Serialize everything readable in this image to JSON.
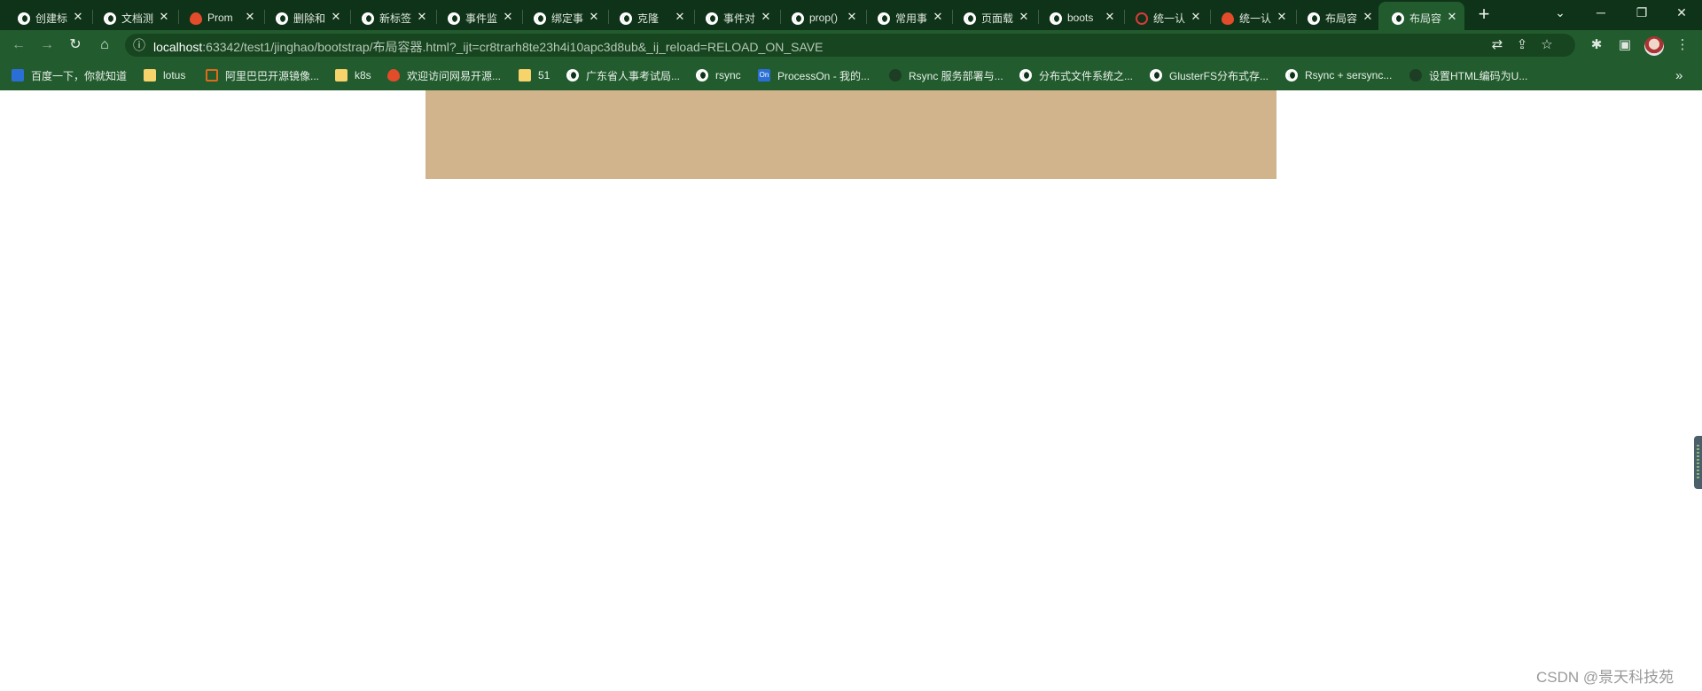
{
  "browser": {
    "tabs": [
      {
        "title": "创建标",
        "icon": "globe-icon"
      },
      {
        "title": "文档测",
        "icon": "globe-icon"
      },
      {
        "title": "Prom",
        "icon": "flame-icon"
      },
      {
        "title": "删除和",
        "icon": "globe-icon"
      },
      {
        "title": "新标签",
        "icon": "chrome-icon"
      },
      {
        "title": "事件监",
        "icon": "globe-icon"
      },
      {
        "title": "绑定事",
        "icon": "globe-icon"
      },
      {
        "title": "克隆",
        "icon": "globe-icon"
      },
      {
        "title": "事件对",
        "icon": "globe-icon"
      },
      {
        "title": "prop()",
        "icon": "globe-icon"
      },
      {
        "title": "常用事",
        "icon": "globe-icon"
      },
      {
        "title": "页面载",
        "icon": "globe-icon"
      },
      {
        "title": "boots",
        "icon": "globe-icon"
      },
      {
        "title": "统一认",
        "icon": "red-circle-icon"
      },
      {
        "title": "统一认",
        "icon": "colorful-icon"
      },
      {
        "title": "布局容",
        "icon": "globe-icon"
      },
      {
        "title": "布局容",
        "icon": "globe-icon",
        "active": true
      }
    ],
    "tab_close_glyph": "✕",
    "new_tab_glyph": "+",
    "window_controls": [
      "⌄",
      "─",
      "❐",
      "✕"
    ],
    "address": {
      "host": "localhost",
      "rest": ":63342/test1/jinghao/bootstrap/布局容器.html?_ijt=cr8trarh8te23h4i10apc3d8ub&_ij_reload=RELOAD_ON_SAVE"
    },
    "nav": {
      "back": "←",
      "forward": "→",
      "reload": "↻",
      "home": "⌂",
      "info": "ⓘ"
    },
    "toolbar_icons": {
      "translate": "⇄",
      "share": "⇪",
      "star": "☆",
      "extensions": "✱",
      "sidepanel": "▣",
      "menu": "⋮"
    },
    "bookmarks": [
      {
        "label": "百度一下，你就知道",
        "icon": "baidu-icon"
      },
      {
        "label": "lotus",
        "icon": "folder-icon"
      },
      {
        "label": "阿里巴巴开源镜像...",
        "icon": "aliyun-icon"
      },
      {
        "label": "k8s",
        "icon": "folder-icon"
      },
      {
        "label": "欢迎访问网易开源...",
        "icon": "netease-icon"
      },
      {
        "label": "51",
        "icon": "folder-icon"
      },
      {
        "label": "广东省人事考试局...",
        "icon": "globe-icon"
      },
      {
        "label": "rsync",
        "icon": "globe-icon"
      },
      {
        "label": "ProcessOn - 我的...",
        "icon": "processon-icon"
      },
      {
        "label": "Rsync 服务部署与...",
        "icon": "dark-icon"
      },
      {
        "label": "分布式文件系统之...",
        "icon": "globe-icon"
      },
      {
        "label": "GlusterFS分布式存...",
        "icon": "globe-icon"
      },
      {
        "label": "Rsync + sersync...",
        "icon": "globe-icon"
      },
      {
        "label": "设置HTML编码为U...",
        "icon": "dark-icon"
      }
    ],
    "bookmarks_overflow": "»"
  },
  "page": {
    "box_color": "#d2b48c",
    "watermark": "CSDN @景天科技苑"
  },
  "colors": {
    "tab_strip": "#0f3318",
    "toolbar": "#225c2e",
    "omnibox": "#17451f"
  }
}
